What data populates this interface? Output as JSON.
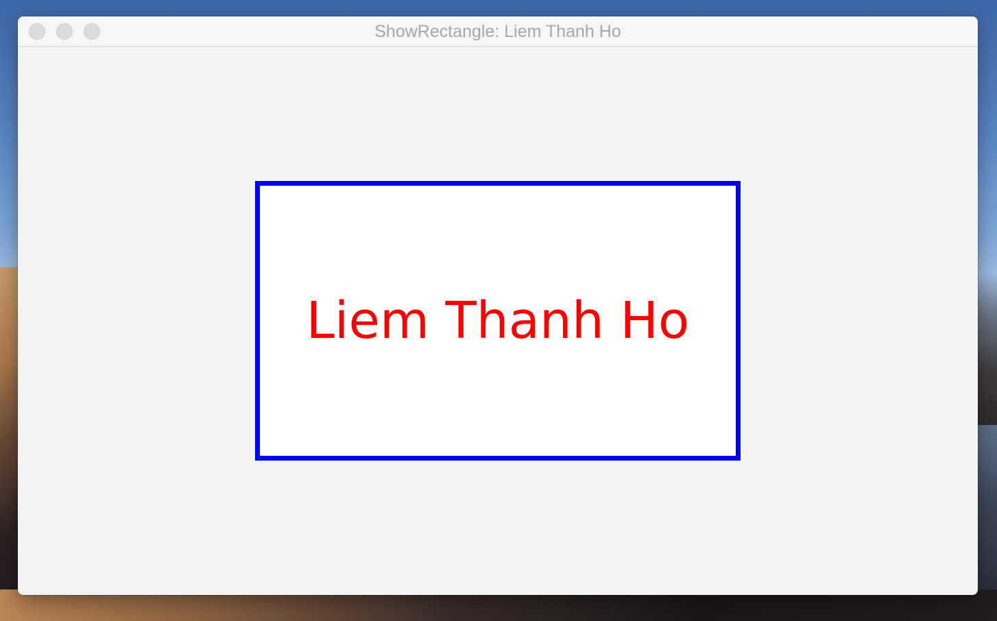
{
  "window": {
    "title": "ShowRectangle: Liem Thanh Ho"
  },
  "canvas": {
    "text": "Liem Thanh Ho",
    "rectangle_stroke_color": "#0000ff",
    "rectangle_fill_color": "#ffffff",
    "text_color": "#ff0000"
  }
}
